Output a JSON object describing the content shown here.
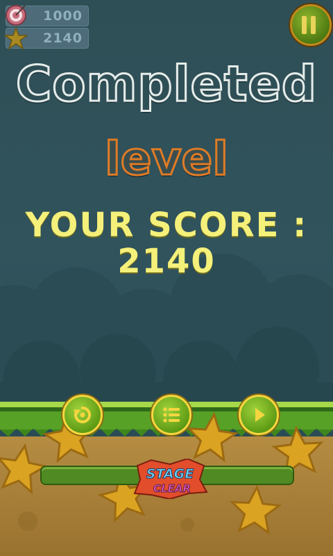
{
  "hud": {
    "target_score": "1000",
    "current_score": "2140"
  },
  "title": {
    "line1": "Completed",
    "line2": "level"
  },
  "score": {
    "label": "YOUR SCORE :",
    "value": "2140"
  },
  "badge": {
    "line1": "STAGE",
    "line2": "CLEAR"
  },
  "colors": {
    "background": "#2f4f56",
    "score_text": "#f4f07a",
    "level_outline": "#e07b25",
    "button_green": "#7dbb24",
    "button_rim": "#f6d640"
  },
  "icons": [
    "target-icon",
    "star-icon",
    "pause-icon",
    "replay-icon",
    "menu-list-icon",
    "play-icon"
  ]
}
